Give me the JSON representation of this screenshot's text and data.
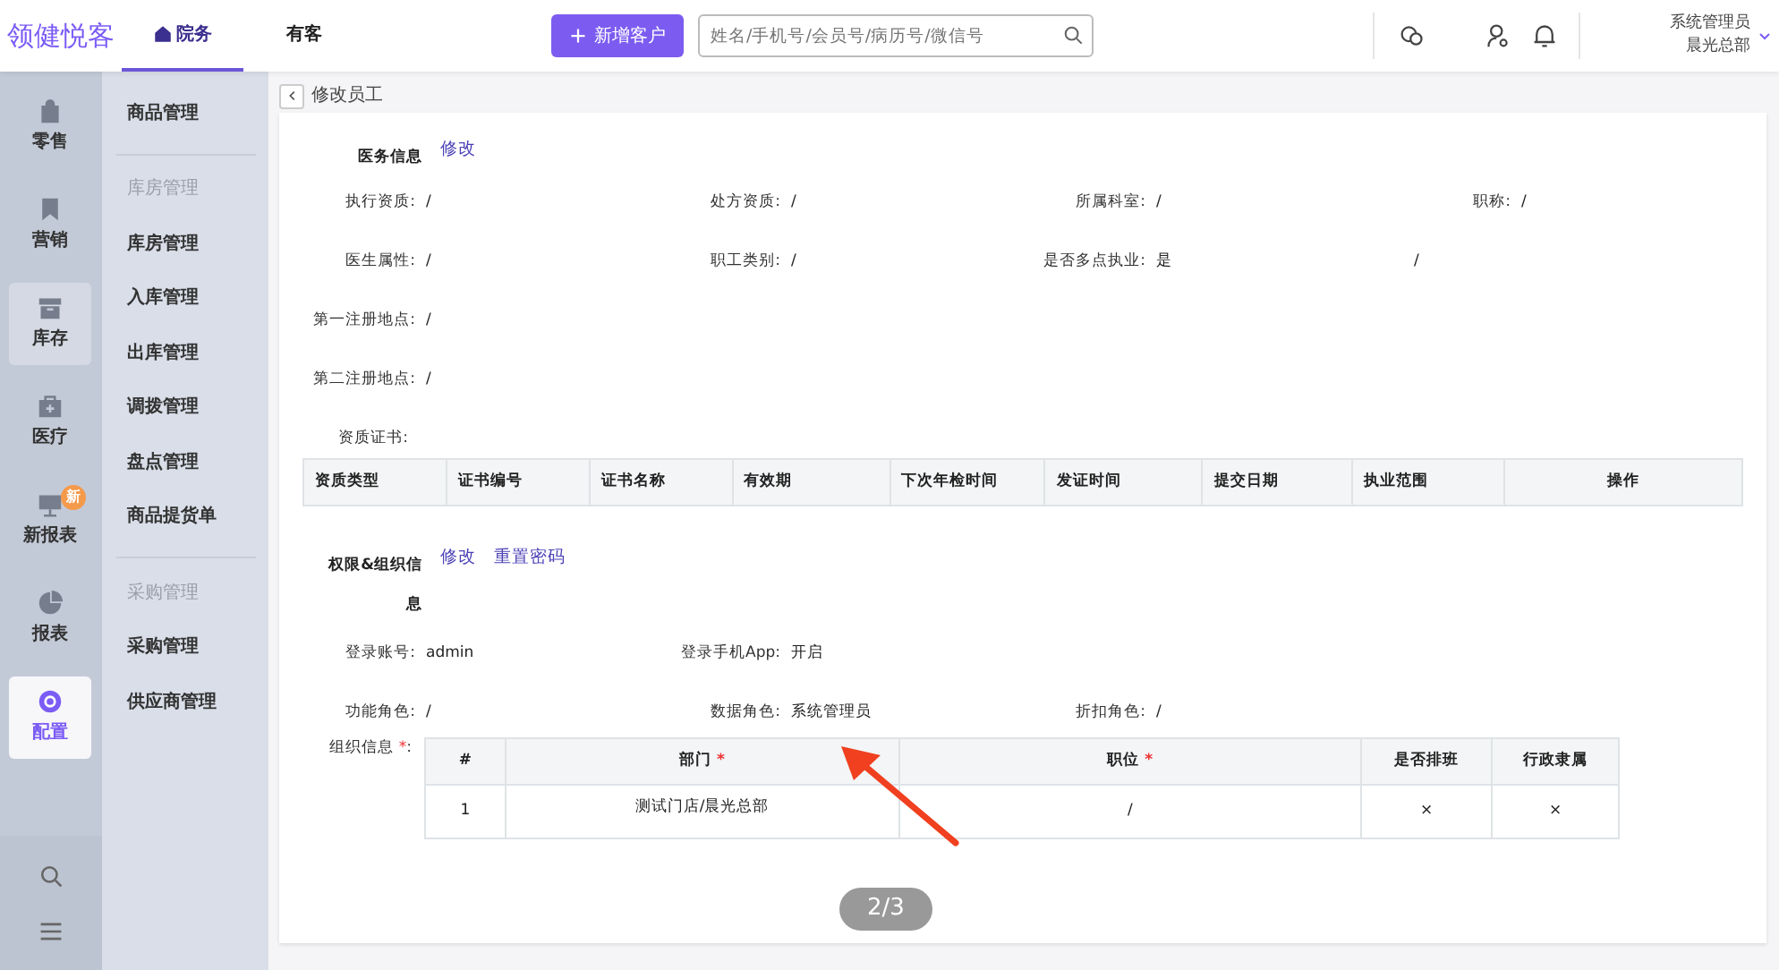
{
  "header": {
    "logo": "领健悦客",
    "tabs": [
      {
        "label": "院务",
        "selected": true
      },
      {
        "label": "有客",
        "selected": false
      }
    ],
    "new_button": "新增客户",
    "search": {
      "placeholder": "姓名/手机号/会员号/病历号/微信号"
    },
    "user": {
      "name": "系统管理员",
      "org": "晨光总部"
    }
  },
  "rail": [
    {
      "label": "零售",
      "selected": false,
      "highlighted": false
    },
    {
      "label": "营销",
      "selected": false,
      "highlighted": false
    },
    {
      "label": "库存",
      "selected": false,
      "highlighted": true
    },
    {
      "label": "医疗",
      "selected": false,
      "highlighted": false
    },
    {
      "label": "新报表",
      "selected": false,
      "highlighted": false,
      "badge": "新"
    },
    {
      "label": "报表",
      "selected": false,
      "highlighted": false
    },
    {
      "label": "配置",
      "selected": true,
      "highlighted": false
    }
  ],
  "submenu": [
    {
      "kind": "link",
      "label": "商品管理"
    },
    {
      "kind": "divider"
    },
    {
      "kind": "heading",
      "label": "库房管理"
    },
    {
      "kind": "link",
      "label": "库房管理"
    },
    {
      "kind": "link",
      "label": "入库管理"
    },
    {
      "kind": "link",
      "label": "出库管理"
    },
    {
      "kind": "link",
      "label": "调拨管理"
    },
    {
      "kind": "link",
      "label": "盘点管理"
    },
    {
      "kind": "link",
      "label": "商品提货单"
    },
    {
      "kind": "divider"
    },
    {
      "kind": "heading",
      "label": "采购管理"
    },
    {
      "kind": "link",
      "label": "采购管理"
    },
    {
      "kind": "link",
      "label": "供应商管理"
    }
  ],
  "breadcrumb": "修改员工",
  "medical": {
    "title": "医务信息",
    "actions": [
      "修改"
    ],
    "rows": [
      [
        {
          "label": "执行资质:",
          "value": "/"
        },
        {
          "label": "处方资质:",
          "value": "/"
        },
        {
          "label": "所属科室:",
          "value": "/"
        },
        {
          "label": "职称:",
          "value": "/"
        }
      ],
      [
        {
          "label": "医生属性:",
          "value": "/"
        },
        {
          "label": "职工类别:",
          "value": "/"
        },
        {
          "label": "是否多点执业:",
          "value": "是",
          "extra": "/"
        }
      ],
      [
        {
          "label": "第一注册地点:",
          "value": "/"
        }
      ],
      [
        {
          "label": "第二注册地点:",
          "value": "/"
        }
      ]
    ],
    "cert_label": "资质证书:",
    "cert_columns": [
      "资质类型",
      "证书编号",
      "证书名称",
      "有效期",
      "下次年检时间",
      "发证时间",
      "提交日期",
      "执业范围",
      "操作"
    ]
  },
  "permission": {
    "title": "权限&组织信息",
    "actions": [
      "修改",
      "重置密码"
    ],
    "rows": [
      [
        {
          "label": "登录账号:",
          "value": "admin"
        },
        {
          "label": "登录手机App:",
          "value": "开启"
        }
      ],
      [
        {
          "label": "功能角色:",
          "value": "/"
        },
        {
          "label": "数据角色:",
          "value": "系统管理员"
        },
        {
          "label": "折扣角色:",
          "value": "/"
        }
      ]
    ],
    "org_label": "组织信息",
    "org_required_mark": "*",
    "org_colon": ":",
    "org_columns": [
      {
        "label": "#"
      },
      {
        "label": "部门",
        "required_mark": "*"
      },
      {
        "label": "职位",
        "required_mark": "*"
      },
      {
        "label": "是否排班"
      },
      {
        "label": "行政隶属"
      }
    ],
    "org_rows": [
      [
        "1",
        "测试门店/晨光总部",
        "/",
        "×",
        "×"
      ]
    ]
  },
  "pager": "2/3"
}
